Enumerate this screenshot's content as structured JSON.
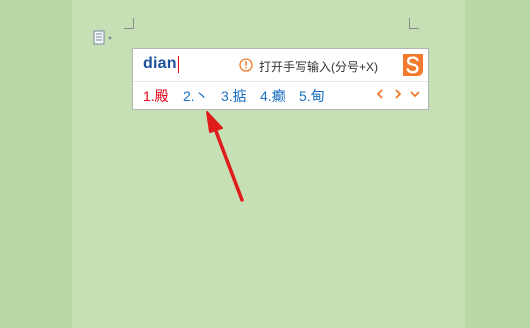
{
  "ime": {
    "pinyin": "dian",
    "handwrite_hint": "打开手写输入(分号+X)",
    "candidates": [
      {
        "label": "1.殿",
        "selected": true
      },
      {
        "label": "2.丶",
        "selected": false
      },
      {
        "label": "3.掂",
        "selected": false
      },
      {
        "label": "4.癫",
        "selected": false
      },
      {
        "label": "5.甸",
        "selected": false
      }
    ],
    "icons": {
      "info": "info-circle-icon",
      "logo": "sogou-logo-icon",
      "prev": "chevron-left-icon",
      "next": "chevron-right-icon",
      "more": "chevron-down-icon"
    }
  },
  "document": {
    "icon": "document-paste-icon"
  },
  "colors": {
    "background": "#c6dfb5",
    "accent_red": "#e60012",
    "candidate_blue": "#1b6fc2",
    "pinyin_blue": "#1c4f9c",
    "nav_orange": "#f07a2a"
  }
}
